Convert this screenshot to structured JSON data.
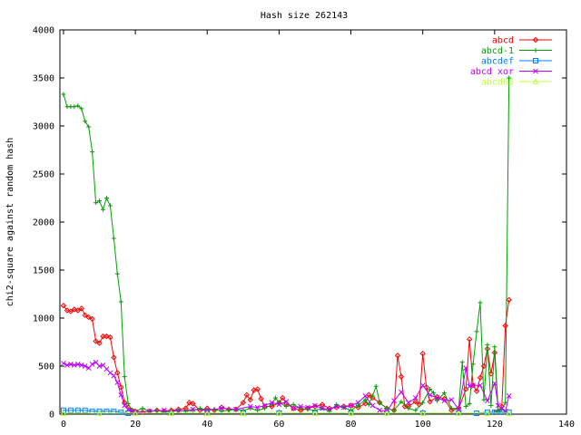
{
  "chart_data": {
    "type": "line",
    "title": "Hash size 262143",
    "xlabel": "",
    "ylabel": "chi2-square against random hash",
    "xlim": [
      -1,
      140
    ],
    "ylim": [
      0,
      4000
    ],
    "xticks": [
      0,
      20,
      40,
      60,
      80,
      100,
      120,
      140
    ],
    "yticks": [
      0,
      500,
      1000,
      1500,
      2000,
      2500,
      3000,
      3500,
      4000
    ],
    "grid": false,
    "legend": "top-right",
    "series": [
      {
        "name": "abcd",
        "color": "#ff0000",
        "marker": "diamond",
        "points": [
          [
            0,
            1130
          ],
          [
            1,
            1080
          ],
          [
            2,
            1070
          ],
          [
            3,
            1090
          ],
          [
            4,
            1080
          ],
          [
            5,
            1100
          ],
          [
            6,
            1030
          ],
          [
            7,
            1010
          ],
          [
            8,
            990
          ],
          [
            9,
            760
          ],
          [
            10,
            740
          ],
          [
            11,
            810
          ],
          [
            12,
            810
          ],
          [
            13,
            800
          ],
          [
            14,
            590
          ],
          [
            15,
            430
          ],
          [
            16,
            280
          ],
          [
            17,
            120
          ],
          [
            18,
            70
          ],
          [
            19,
            40
          ],
          [
            20,
            30
          ],
          [
            22,
            20
          ],
          [
            24,
            30
          ],
          [
            26,
            40
          ],
          [
            28,
            30
          ],
          [
            30,
            40
          ],
          [
            32,
            50
          ],
          [
            34,
            60
          ],
          [
            35,
            120
          ],
          [
            36,
            110
          ],
          [
            38,
            40
          ],
          [
            40,
            60
          ],
          [
            42,
            40
          ],
          [
            44,
            70
          ],
          [
            46,
            50
          ],
          [
            48,
            50
          ],
          [
            50,
            120
          ],
          [
            51,
            200
          ],
          [
            52,
            150
          ],
          [
            53,
            250
          ],
          [
            54,
            260
          ],
          [
            55,
            160
          ],
          [
            56,
            80
          ],
          [
            58,
            80
          ],
          [
            60,
            120
          ],
          [
            61,
            170
          ],
          [
            62,
            110
          ],
          [
            64,
            60
          ],
          [
            66,
            40
          ],
          [
            68,
            60
          ],
          [
            70,
            80
          ],
          [
            72,
            100
          ],
          [
            74,
            60
          ],
          [
            76,
            70
          ],
          [
            78,
            80
          ],
          [
            80,
            90
          ],
          [
            82,
            70
          ],
          [
            84,
            110
          ],
          [
            85,
            200
          ],
          [
            86,
            170
          ],
          [
            88,
            120
          ],
          [
            90,
            60
          ],
          [
            92,
            40
          ],
          [
            93,
            610
          ],
          [
            94,
            390
          ],
          [
            95,
            80
          ],
          [
            96,
            80
          ],
          [
            98,
            130
          ],
          [
            99,
            100
          ],
          [
            100,
            630
          ],
          [
            101,
            280
          ],
          [
            102,
            130
          ],
          [
            104,
            180
          ],
          [
            106,
            160
          ],
          [
            108,
            40
          ],
          [
            110,
            60
          ],
          [
            112,
            260
          ],
          [
            113,
            780
          ],
          [
            114,
            300
          ],
          [
            115,
            240
          ],
          [
            116,
            380
          ],
          [
            117,
            500
          ],
          [
            118,
            680
          ],
          [
            119,
            420
          ],
          [
            120,
            640
          ],
          [
            121,
            30
          ],
          [
            122,
            80
          ],
          [
            123,
            920
          ],
          [
            124,
            1190
          ]
        ]
      },
      {
        "name": "abcd-1",
        "color": "#00a000",
        "marker": "plus",
        "points": [
          [
            0,
            3330
          ],
          [
            1,
            3200
          ],
          [
            2,
            3200
          ],
          [
            3,
            3200
          ],
          [
            4,
            3210
          ],
          [
            5,
            3180
          ],
          [
            6,
            3050
          ],
          [
            7,
            2990
          ],
          [
            8,
            2730
          ],
          [
            9,
            2200
          ],
          [
            10,
            2220
          ],
          [
            11,
            2130
          ],
          [
            12,
            2250
          ],
          [
            13,
            2170
          ],
          [
            14,
            1830
          ],
          [
            15,
            1460
          ],
          [
            16,
            1170
          ],
          [
            17,
            390
          ],
          [
            18,
            110
          ],
          [
            19,
            40
          ],
          [
            20,
            30
          ],
          [
            22,
            60
          ],
          [
            24,
            30
          ],
          [
            26,
            40
          ],
          [
            28,
            20
          ],
          [
            30,
            30
          ],
          [
            32,
            40
          ],
          [
            34,
            30
          ],
          [
            36,
            40
          ],
          [
            38,
            60
          ],
          [
            40,
            40
          ],
          [
            42,
            50
          ],
          [
            44,
            30
          ],
          [
            46,
            40
          ],
          [
            48,
            50
          ],
          [
            50,
            40
          ],
          [
            52,
            60
          ],
          [
            54,
            40
          ],
          [
            56,
            60
          ],
          [
            58,
            100
          ],
          [
            59,
            170
          ],
          [
            60,
            120
          ],
          [
            62,
            80
          ],
          [
            64,
            100
          ],
          [
            66,
            60
          ],
          [
            68,
            50
          ],
          [
            70,
            40
          ],
          [
            72,
            60
          ],
          [
            74,
            30
          ],
          [
            76,
            100
          ],
          [
            78,
            70
          ],
          [
            80,
            40
          ],
          [
            82,
            90
          ],
          [
            84,
            150
          ],
          [
            85,
            100
          ],
          [
            86,
            190
          ],
          [
            87,
            290
          ],
          [
            88,
            120
          ],
          [
            90,
            60
          ],
          [
            92,
            40
          ],
          [
            94,
            130
          ],
          [
            96,
            60
          ],
          [
            98,
            40
          ],
          [
            100,
            120
          ],
          [
            102,
            260
          ],
          [
            103,
            220
          ],
          [
            104,
            140
          ],
          [
            106,
            220
          ],
          [
            108,
            60
          ],
          [
            110,
            60
          ],
          [
            111,
            540
          ],
          [
            112,
            80
          ],
          [
            113,
            110
          ],
          [
            114,
            520
          ],
          [
            115,
            860
          ],
          [
            116,
            1160
          ],
          [
            117,
            150
          ],
          [
            118,
            720
          ],
          [
            119,
            90
          ],
          [
            120,
            700
          ],
          [
            121,
            30
          ],
          [
            122,
            50
          ],
          [
            123,
            120
          ],
          [
            124,
            3500
          ]
        ]
      },
      {
        "name": "abcdef",
        "color": "#0080ff",
        "marker": "square",
        "points": [
          [
            0,
            40
          ],
          [
            2,
            40
          ],
          [
            4,
            40
          ],
          [
            6,
            40
          ],
          [
            8,
            30
          ],
          [
            10,
            30
          ],
          [
            12,
            30
          ],
          [
            14,
            30
          ],
          [
            16,
            20
          ],
          [
            18,
            10
          ],
          [
            20,
            10
          ],
          [
            30,
            10
          ],
          [
            40,
            10
          ],
          [
            50,
            10
          ],
          [
            60,
            10
          ],
          [
            70,
            10
          ],
          [
            80,
            10
          ],
          [
            90,
            10
          ],
          [
            100,
            10
          ],
          [
            110,
            10
          ],
          [
            115,
            10
          ],
          [
            118,
            20
          ],
          [
            120,
            20
          ],
          [
            122,
            20
          ],
          [
            124,
            20
          ]
        ]
      },
      {
        "name": "abcd xor",
        "color": "#c000ff",
        "marker": "cross",
        "points": [
          [
            0,
            530
          ],
          [
            1,
            510
          ],
          [
            2,
            520
          ],
          [
            3,
            510
          ],
          [
            4,
            520
          ],
          [
            5,
            510
          ],
          [
            6,
            500
          ],
          [
            7,
            480
          ],
          [
            8,
            520
          ],
          [
            9,
            540
          ],
          [
            10,
            500
          ],
          [
            11,
            510
          ],
          [
            12,
            470
          ],
          [
            13,
            430
          ],
          [
            14,
            400
          ],
          [
            15,
            330
          ],
          [
            16,
            200
          ],
          [
            17,
            90
          ],
          [
            18,
            50
          ],
          [
            19,
            30
          ],
          [
            20,
            20
          ],
          [
            24,
            30
          ],
          [
            28,
            40
          ],
          [
            32,
            30
          ],
          [
            36,
            50
          ],
          [
            40,
            40
          ],
          [
            44,
            60
          ],
          [
            48,
            50
          ],
          [
            52,
            80
          ],
          [
            54,
            70
          ],
          [
            56,
            90
          ],
          [
            58,
            120
          ],
          [
            60,
            100
          ],
          [
            62,
            130
          ],
          [
            64,
            60
          ],
          [
            66,
            80
          ],
          [
            68,
            70
          ],
          [
            70,
            90
          ],
          [
            72,
            60
          ],
          [
            74,
            50
          ],
          [
            76,
            80
          ],
          [
            78,
            70
          ],
          [
            80,
            90
          ],
          [
            82,
            120
          ],
          [
            84,
            190
          ],
          [
            86,
            90
          ],
          [
            88,
            40
          ],
          [
            90,
            30
          ],
          [
            92,
            140
          ],
          [
            94,
            230
          ],
          [
            96,
            120
          ],
          [
            98,
            170
          ],
          [
            100,
            300
          ],
          [
            102,
            200
          ],
          [
            104,
            170
          ],
          [
            106,
            140
          ],
          [
            108,
            150
          ],
          [
            110,
            50
          ],
          [
            112,
            480
          ],
          [
            113,
            290
          ],
          [
            114,
            300
          ],
          [
            116,
            300
          ],
          [
            118,
            140
          ],
          [
            120,
            320
          ],
          [
            121,
            90
          ],
          [
            122,
            60
          ],
          [
            123,
            30
          ],
          [
            124,
            190
          ]
        ]
      },
      {
        "name": "abcd65",
        "color": "#c0ff40",
        "marker": "triangle",
        "points": [
          [
            0,
            10
          ],
          [
            10,
            10
          ],
          [
            20,
            10
          ],
          [
            30,
            10
          ],
          [
            40,
            10
          ],
          [
            50,
            10
          ],
          [
            60,
            10
          ],
          [
            70,
            10
          ],
          [
            80,
            10
          ],
          [
            90,
            10
          ],
          [
            100,
            10
          ],
          [
            110,
            10
          ],
          [
            118,
            10
          ],
          [
            124,
            10
          ]
        ]
      }
    ]
  }
}
